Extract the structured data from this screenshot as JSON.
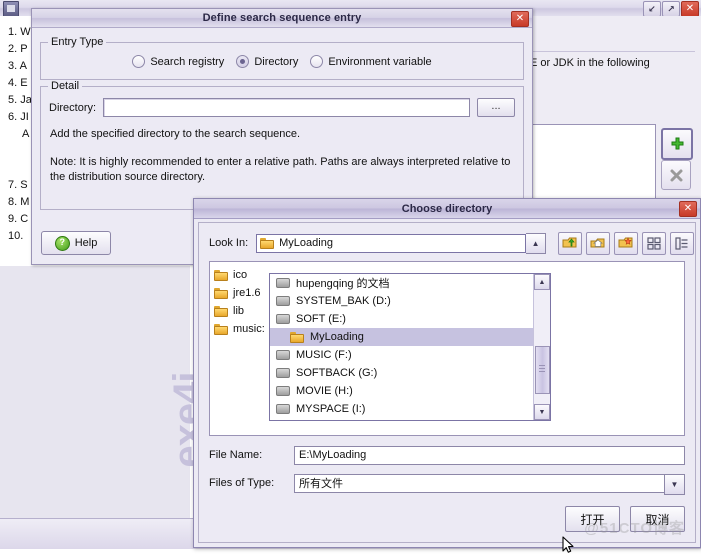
{
  "background_window": {
    "title": "",
    "app_icon": "app-icon",
    "window_buttons": {
      "minimize": "↙",
      "maximize": "↗",
      "close": "✕"
    },
    "left_list": [
      "1. W",
      "2. P",
      "3. A",
      "4. E",
      "5. Ja",
      "6. JI",
      "A",
      "·",
      "·",
      "7. S",
      "8. M",
      "9. C",
      "10."
    ],
    "right_text": "RE or JDK in the following",
    "add_button_label": "+",
    "delete_button_label": "✕",
    "watermark": "exe4j"
  },
  "dialog_entry": {
    "title": "Define search sequence entry",
    "close_label": "✕",
    "entry_type": {
      "legend": "Entry Type",
      "options": [
        {
          "label": "Search registry",
          "selected": false
        },
        {
          "label": "Directory",
          "selected": true
        },
        {
          "label": "Environment variable",
          "selected": false
        }
      ]
    },
    "detail": {
      "legend": "Detail",
      "directory_label": "Directory:",
      "directory_value": "",
      "directory_placeholder": "",
      "browse_label": "...",
      "description": "Add the specified directory to the search sequence.",
      "note_line1": "Note: It is highly recommended to enter a relative path. Paths are always interpreted relative to",
      "note_line2": "the distribution source directory."
    },
    "help_label": "Help",
    "help_glyph": "?"
  },
  "dialog_choose": {
    "title": "Choose directory",
    "close_label": "✕",
    "look_in_label": "Look In:",
    "look_in_value": "MyLoading",
    "look_in_arrow": "▲",
    "toolbar": [
      {
        "name": "up-one-level-icon",
        "glyph": "↑"
      },
      {
        "name": "home-icon",
        "glyph": "⌂"
      },
      {
        "name": "new-folder-icon",
        "glyph": "✦"
      },
      {
        "name": "tiles-view-icon",
        "glyph": "░"
      },
      {
        "name": "details-view-icon",
        "glyph": "≣"
      }
    ],
    "file_items": [
      {
        "label": "ico",
        "icon": "folder-icon"
      },
      {
        "label": "jre1.6",
        "icon": "folder-icon"
      },
      {
        "label": "lib",
        "icon": "folder-icon"
      },
      {
        "label": "music:",
        "icon": "folder-icon"
      }
    ],
    "dropdown_items": [
      {
        "label": "hupengqing 的文档",
        "icon": "drive-icon",
        "indent": false,
        "selected": false
      },
      {
        "label": "SYSTEM_BAK (D:)",
        "icon": "drive-icon",
        "indent": false,
        "selected": false
      },
      {
        "label": "SOFT (E:)",
        "icon": "drive-icon",
        "indent": false,
        "selected": false
      },
      {
        "label": "MyLoading",
        "icon": "folder-icon",
        "indent": true,
        "selected": true
      },
      {
        "label": "MUSIC (F:)",
        "icon": "drive-icon",
        "indent": false,
        "selected": false
      },
      {
        "label": "SOFTBACK (G:)",
        "icon": "drive-icon",
        "indent": false,
        "selected": false
      },
      {
        "label": "MOVIE (H:)",
        "icon": "drive-icon",
        "indent": false,
        "selected": false
      },
      {
        "label": "MYSPACE (I:)",
        "icon": "drive-icon",
        "indent": false,
        "selected": false
      }
    ],
    "scroll_up": "▲",
    "scroll_down": "▼",
    "file_name_label": "File Name:",
    "file_name_value": "E:\\MyLoading",
    "files_of_type_label": "Files of Type:",
    "files_of_type_value": "所有文件",
    "files_of_type_arrow": "▼",
    "open_button": "打开",
    "cancel_button": "取消"
  },
  "watermark": "@51CTO博客"
}
